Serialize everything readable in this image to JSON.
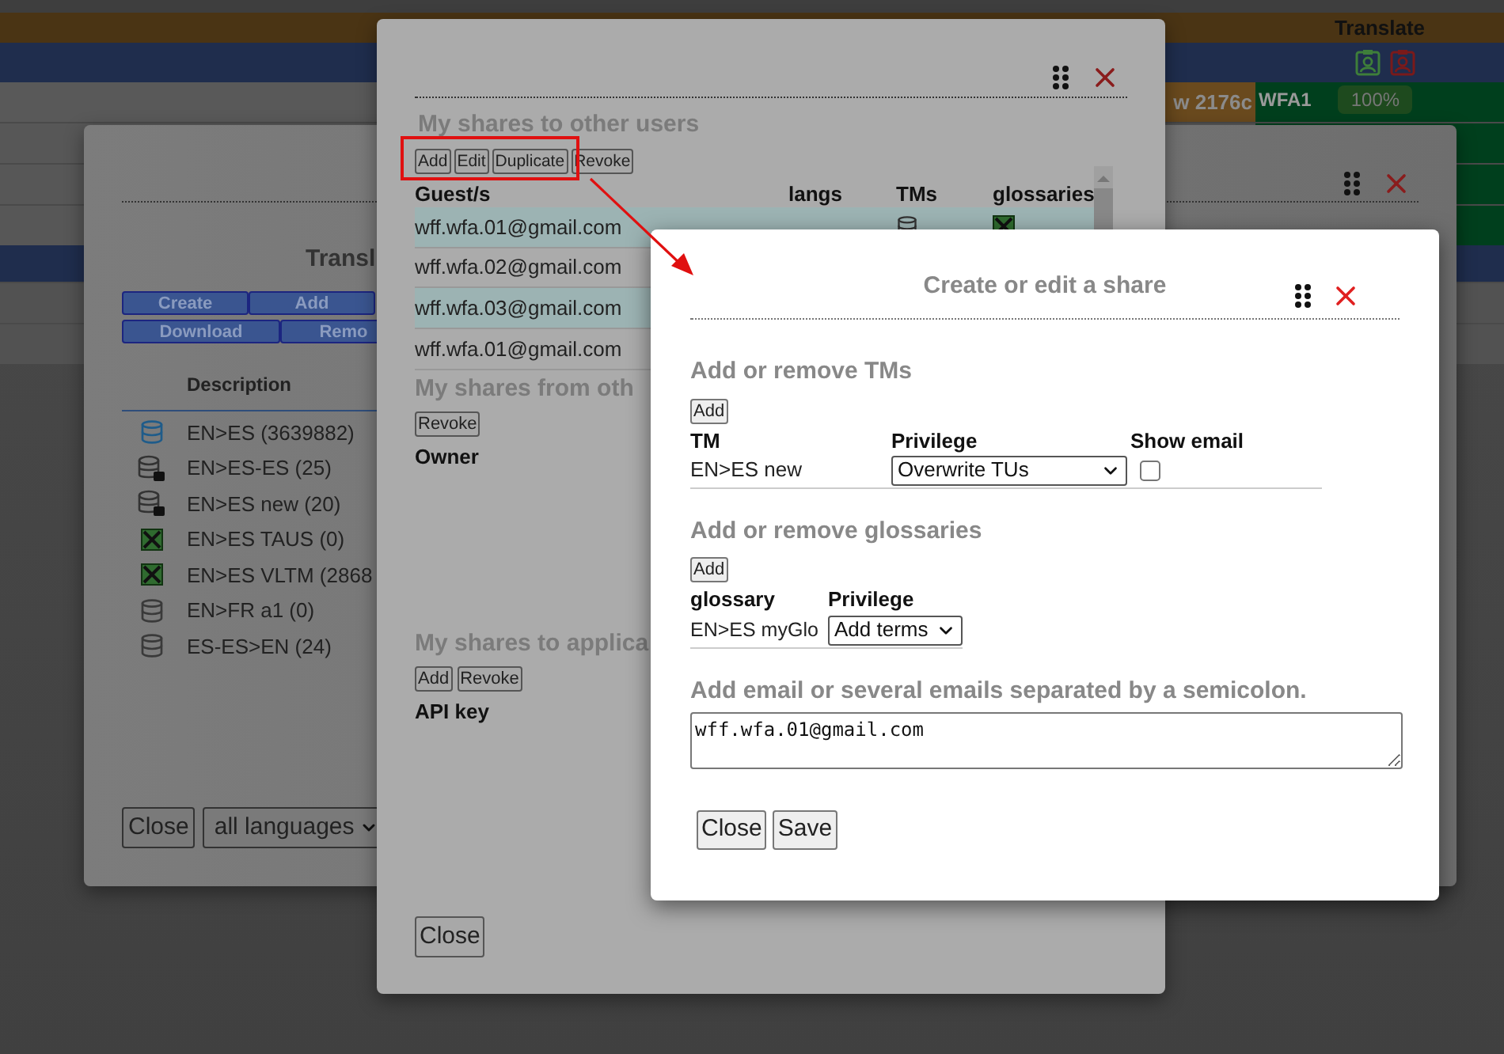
{
  "background": {
    "header": "Translate",
    "row": {
      "words": "w 2176c",
      "user": "WFA1",
      "progress": "100%"
    }
  },
  "tm_window": {
    "title": "Transl",
    "buttons": [
      "Create",
      "Add",
      "Download",
      "Remo"
    ],
    "column": "Description",
    "items": [
      {
        "kind": "tm-shared",
        "name": "EN>ES (3639882)"
      },
      {
        "kind": "tm-locked",
        "name": "EN>ES-ES (25)"
      },
      {
        "kind": "tm-locked",
        "name": "EN>ES new (20)"
      },
      {
        "kind": "glossary",
        "name": "EN>ES TAUS (0)"
      },
      {
        "kind": "glossary",
        "name": "EN>ES VLTM (2868"
      },
      {
        "kind": "tm",
        "name": "EN>FR a1 (0)"
      },
      {
        "kind": "tm",
        "name": "ES-ES>EN (24)"
      }
    ],
    "close": "Close",
    "language_select": "all languages"
  },
  "shares_window": {
    "users": {
      "title": "My shares to other users",
      "buttons": [
        "Add",
        "Edit",
        "Duplicate",
        "Revoke"
      ],
      "columns": [
        "Guest/s",
        "langs",
        "TMs",
        "glossaries"
      ],
      "rows": [
        {
          "guest": "wff.wfa.01@gmail.com",
          "kind": "with-resources",
          "selected": true
        },
        {
          "guest": "wff.wfa.02@gmail.com",
          "kind": "plain",
          "selected": false
        },
        {
          "guest": "wff.wfa.03@gmail.com",
          "kind": "plain",
          "selected": true
        },
        {
          "guest": "wff.wfa.01@gmail.com",
          "kind": "plain",
          "selected": false
        }
      ]
    },
    "from_others": {
      "title": "My shares from oth",
      "buttons": [
        "Revoke"
      ],
      "column": "Owner"
    },
    "applications": {
      "title": "My shares to applica",
      "buttons": [
        "Add",
        "Revoke"
      ],
      "column": "API key"
    },
    "close": "Close"
  },
  "share_dialog": {
    "title": "Create or edit a share",
    "tm_section": {
      "title": "Add or remove TMs",
      "add": "Add",
      "columns": [
        "TM",
        "Privilege",
        "Show email"
      ],
      "rows": [
        {
          "tm": "EN>ES new",
          "privilege": "Overwrite TUs",
          "show_email": false
        }
      ]
    },
    "glossary_section": {
      "title": "Add or remove glossaries",
      "add": "Add",
      "columns": [
        "glossary",
        "Privilege"
      ],
      "rows": [
        {
          "glossary": "EN>ES myGlo",
          "privilege": "Add terms"
        }
      ]
    },
    "email_section": {
      "label": "Add email or several emails separated by a semicolon.",
      "value": "wff.wfa.01@gmail.com"
    },
    "buttons": [
      "Close",
      "Save"
    ]
  }
}
